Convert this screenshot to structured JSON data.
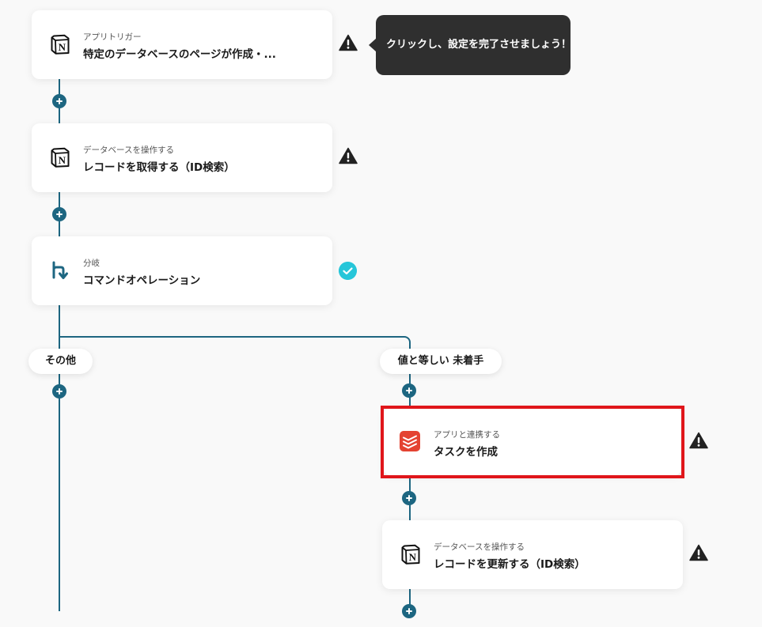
{
  "tooltip": {
    "text": "クリックし、設定を完了させましょう！"
  },
  "steps": [
    {
      "subtitle": "アプリトリガー",
      "title": "特定のデータベースのページが作成・...",
      "icon": "notion-icon",
      "status": "warning"
    },
    {
      "subtitle": "データベースを操作する",
      "title": "レコードを取得する（ID検索）",
      "icon": "notion-icon",
      "status": "warning"
    },
    {
      "subtitle": "分岐",
      "title": "コマンドオペレーション",
      "icon": "branch-icon",
      "status": "complete"
    },
    {
      "subtitle": "アプリと連携する",
      "title": "タスクを作成",
      "icon": "todoist-icon",
      "status": "warning"
    },
    {
      "subtitle": "データベースを操作する",
      "title": "レコードを更新する（ID検索）",
      "icon": "notion-icon",
      "status": "warning"
    }
  ],
  "branches": {
    "left_label": "その他",
    "right_label": "値と等しい 未着手"
  },
  "colors": {
    "connector": "#1d6681",
    "warning": "#222222",
    "complete": "#27c6d9",
    "highlight": "#e0161b",
    "todoist": "#e44332",
    "tooltip_bg": "#2f2f2f"
  }
}
